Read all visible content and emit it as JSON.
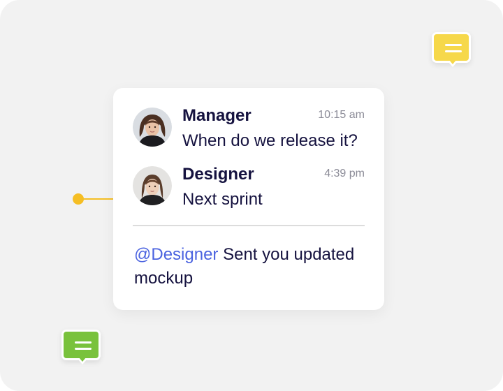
{
  "colors": {
    "background": "#f2f2f2",
    "card": "#ffffff",
    "text_dark": "#15123f",
    "timestamp": "#8b8b97",
    "mention": "#4b63e0",
    "connector": "#f5be24",
    "bubble_yellow": "#f6d84a",
    "bubble_green": "#79c23c"
  },
  "decorations": {
    "top_bubble_icon": "chat-bubble-icon",
    "bottom_bubble_icon": "chat-bubble-icon"
  },
  "chat": {
    "messages": [
      {
        "sender": "Manager",
        "time": "10:15 am",
        "text": "When do we release it?",
        "avatar": "avatar-manager"
      },
      {
        "sender": "Designer",
        "time": "4:39 pm",
        "text": "Next sprint",
        "avatar": "avatar-designer"
      }
    ],
    "notification": {
      "mention": "@Designer",
      "text": " Sent you updated mockup"
    }
  }
}
